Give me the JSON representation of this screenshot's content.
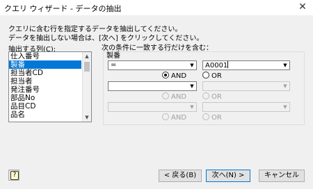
{
  "window": {
    "title": "クエリ ウィザード - データの抽出",
    "close_glyph": "✕"
  },
  "instructions": {
    "line1": "クエリに含む行を指定するデータを抽出してください。",
    "line2": "データを抽出しない場合は、[次へ] をクリックしてください。"
  },
  "columns_label": "抽出する列(C):",
  "columns": [
    "仕入番号",
    "製番",
    "担当者CD",
    "担当者",
    "発注番号",
    "部品No",
    "品目CD",
    "品名"
  ],
  "selected_column": "製番",
  "criteria": {
    "heading": "次の条件に一致する行だけを含む：",
    "field_name": "製番",
    "row1": {
      "operator": "=",
      "value": "A0001"
    },
    "and_label": "AND",
    "or_label": "OR",
    "row2": {
      "operator": "",
      "value": ""
    },
    "row3": {
      "operator": "",
      "value": ""
    }
  },
  "buttons": {
    "back": "< 戻る(B)",
    "next": "次へ(N) >",
    "cancel": "キャンセル",
    "help_glyph": "?"
  }
}
